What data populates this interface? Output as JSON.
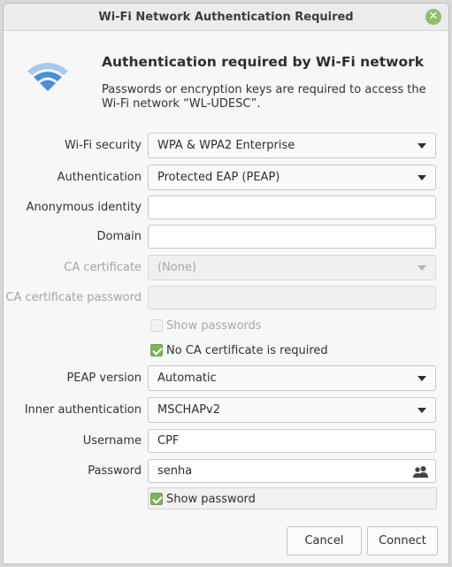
{
  "window": {
    "title": "Wi-Fi Network Authentication Required",
    "close_glyph": "✕"
  },
  "header": {
    "icon": "wifi-icon",
    "heading": "Authentication required by Wi-Fi network",
    "description": "Passwords or encryption keys are required to access the Wi-Fi network “WL-UDESC”."
  },
  "form": {
    "wifi_security": {
      "label": "Wi-Fi security",
      "value": "WPA & WPA2 Enterprise"
    },
    "authentication": {
      "label": "Authentication",
      "value": "Protected EAP (PEAP)"
    },
    "anonymous_identity": {
      "label": "Anonymous identity",
      "value": ""
    },
    "domain": {
      "label": "Domain",
      "value": ""
    },
    "ca_certificate": {
      "label": "CA certificate",
      "value": "(None)"
    },
    "ca_certificate_password": {
      "label": "CA certificate password",
      "value": ""
    },
    "show_passwords": {
      "label": "Show passwords",
      "checked": false,
      "enabled": false
    },
    "no_ca_required": {
      "label": "No CA certificate is required",
      "checked": true
    },
    "peap_version": {
      "label": "PEAP version",
      "value": "Automatic"
    },
    "inner_authentication": {
      "label": "Inner authentication",
      "value": "MSCHAPv2"
    },
    "username": {
      "label": "Username",
      "value": "CPF"
    },
    "password": {
      "label": "Password",
      "value": "senha",
      "icon": "people-icon"
    },
    "show_password": {
      "label": "Show password",
      "checked": true
    }
  },
  "buttons": {
    "cancel": "Cancel",
    "connect": "Connect"
  },
  "colors": {
    "accent": "#7fb35f",
    "wifi_icon": "#4a90d9"
  }
}
